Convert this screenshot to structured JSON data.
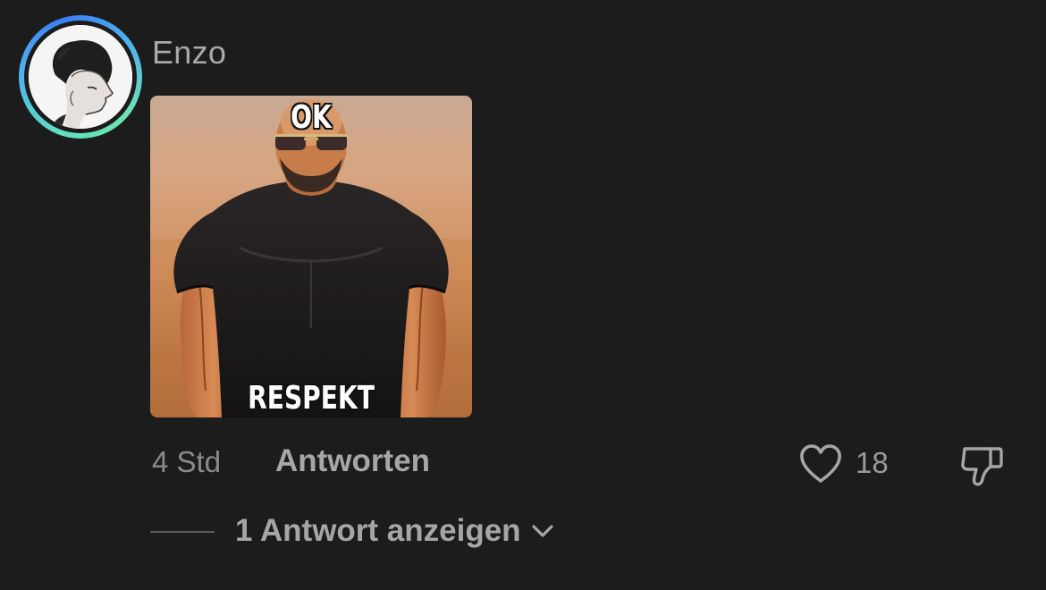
{
  "comment": {
    "username": "Enzo",
    "avatar_icon": "user-avatar",
    "story_ring_colors": [
      "#3a7df5",
      "#4fb3f0",
      "#5fe0c0",
      "#6fe3b0"
    ],
    "image": {
      "top_text": "OK",
      "bottom_text": "RESPEKT"
    },
    "timestamp": "4 Std",
    "reply_label": "Antworten",
    "like_icon": "heart-icon",
    "like_count": "18",
    "dislike_icon": "thumbs-down-icon",
    "view_replies_label": "1 Antwort anzeigen",
    "view_replies_icon": "chevron-down-icon"
  },
  "colors": {
    "background": "#1c1c1c",
    "username": "#a9a9a9",
    "secondary_text": "#8a8a8a",
    "action_text": "#a6a6a6"
  }
}
